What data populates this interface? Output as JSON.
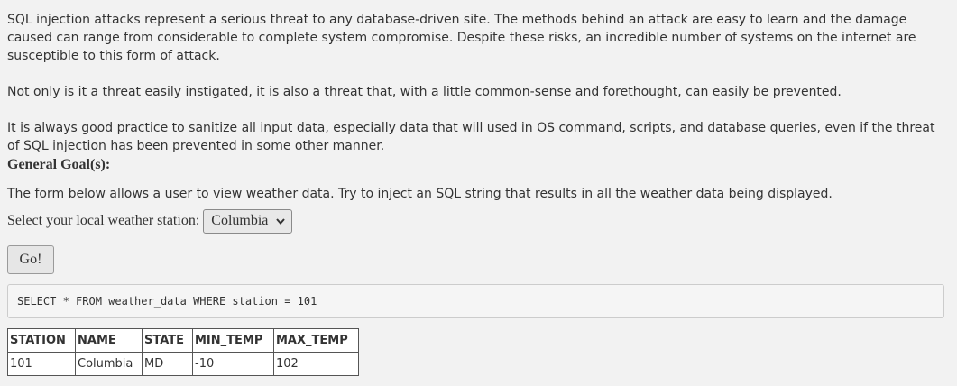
{
  "intro": {
    "paragraphs": [
      "SQL injection attacks represent a serious threat to any database-driven site. The methods behind an attack are easy to learn and the damage caused can range from considerable to complete system compromise. Despite these risks, an incredible number of systems on the internet are susceptible to this form of attack.",
      "Not only is it a threat easily instigated, it is also a threat that, with a little common-sense and forethought, can easily be prevented.",
      "It is always good practice to sanitize all input data, especially data that will used in OS command, scripts, and database queries, even if the threat of SQL injection has been prevented in some other manner."
    ]
  },
  "goal": {
    "heading": "General Goal(s):",
    "text": "The form below allows a user to view weather data. Try to inject an SQL string that results in all the weather data being displayed."
  },
  "form": {
    "station_label": "Select your local weather station:",
    "selected_station": "Columbia",
    "go_label": "Go!"
  },
  "query": {
    "text": "SELECT * FROM weather_data WHERE station = 101"
  },
  "results": {
    "headers": [
      "STATION",
      "NAME",
      "STATE",
      "MIN_TEMP",
      "MAX_TEMP"
    ],
    "rows": [
      [
        "101",
        "Columbia",
        "MD",
        "-10",
        "102"
      ]
    ]
  }
}
